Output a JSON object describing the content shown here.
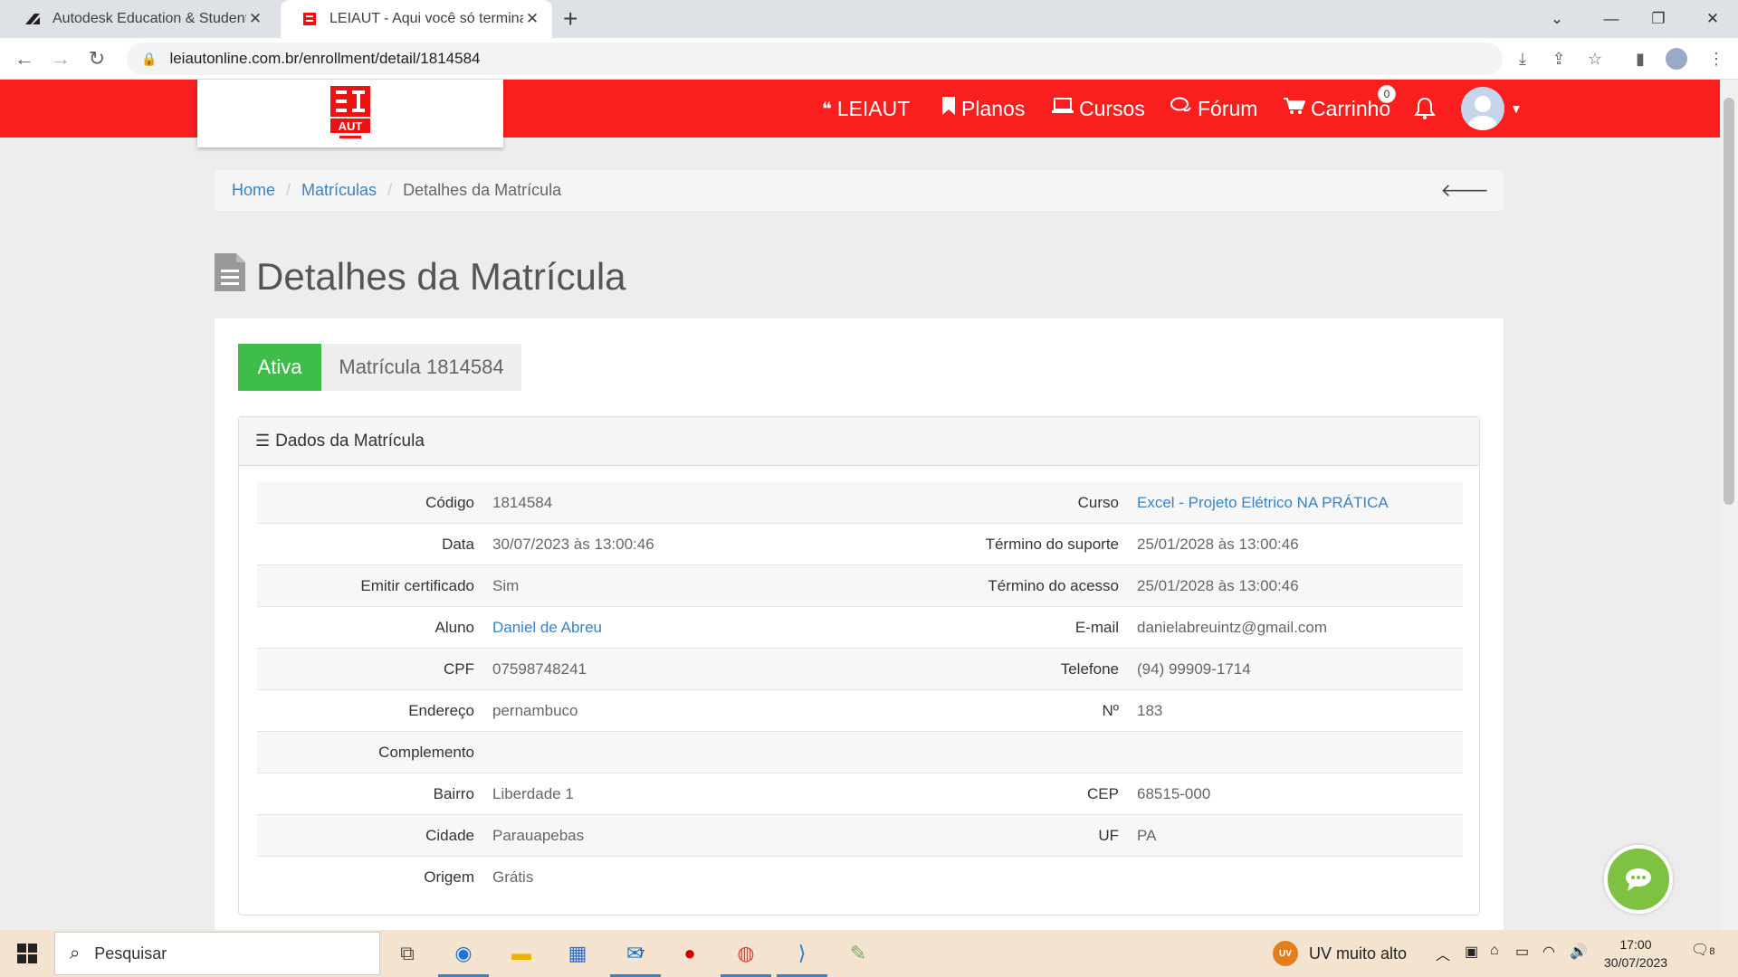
{
  "browser": {
    "tabs": [
      {
        "title": "Autodesk Education & Student A"
      },
      {
        "title": "LEIAUT - Aqui você só termina q"
      }
    ],
    "url": "leiautonline.com.br/enrollment/detail/1814584"
  },
  "navbar": {
    "items": [
      "LEIAUT",
      "Planos",
      "Cursos",
      "Fórum",
      "Carrinho"
    ],
    "cart_count": "0",
    "logo_text": "LEI AUT"
  },
  "breadcrumb": {
    "home": "Home",
    "matriculas": "Matrículas",
    "current": "Detalhes da Matrícula"
  },
  "page": {
    "title": "Detalhes da Matrícula",
    "status": "Ativa",
    "matricula": "Matrícula 1814584",
    "card_title": "Dados da Matrícula"
  },
  "details": {
    "codigo_label": "Código",
    "codigo": "1814584",
    "curso_label": "Curso",
    "curso": "Excel - Projeto Elétrico NA PRÁTICA",
    "data_label": "Data",
    "data": "30/07/2023 às 13:00:46",
    "suporte_label": "Término do suporte",
    "suporte": "25/01/2028 às 13:00:46",
    "certificado_label": "Emitir certificado",
    "certificado": "Sim",
    "acesso_label": "Término do acesso",
    "acesso": "25/01/2028 às 13:00:46",
    "aluno_label": "Aluno",
    "aluno": "Daniel de Abreu",
    "email_label": "E-mail",
    "email": "danielabreuintz@gmail.com",
    "cpf_label": "CPF",
    "cpf": "07598748241",
    "telefone_label": "Telefone",
    "telefone": "(94) 99909-1714",
    "endereco_label": "Endereço",
    "endereco": "pernambuco",
    "numero_label": "Nº",
    "numero": "183",
    "complemento_label": "Complemento",
    "complemento": "",
    "bairro_label": "Bairro",
    "bairro": "Liberdade 1",
    "cep_label": "CEP",
    "cep": "68515-000",
    "cidade_label": "Cidade",
    "cidade": "Parauapebas",
    "uf_label": "UF",
    "uf": "PA",
    "origem_label": "Origem",
    "origem": "Grátis"
  },
  "taskbar": {
    "search_placeholder": "Pesquisar",
    "weather": "UV muito alto",
    "uv_badge": "UV",
    "mail_badge": "7",
    "time": "17:00",
    "date": "30/07/2023",
    "notif_count": "8"
  }
}
